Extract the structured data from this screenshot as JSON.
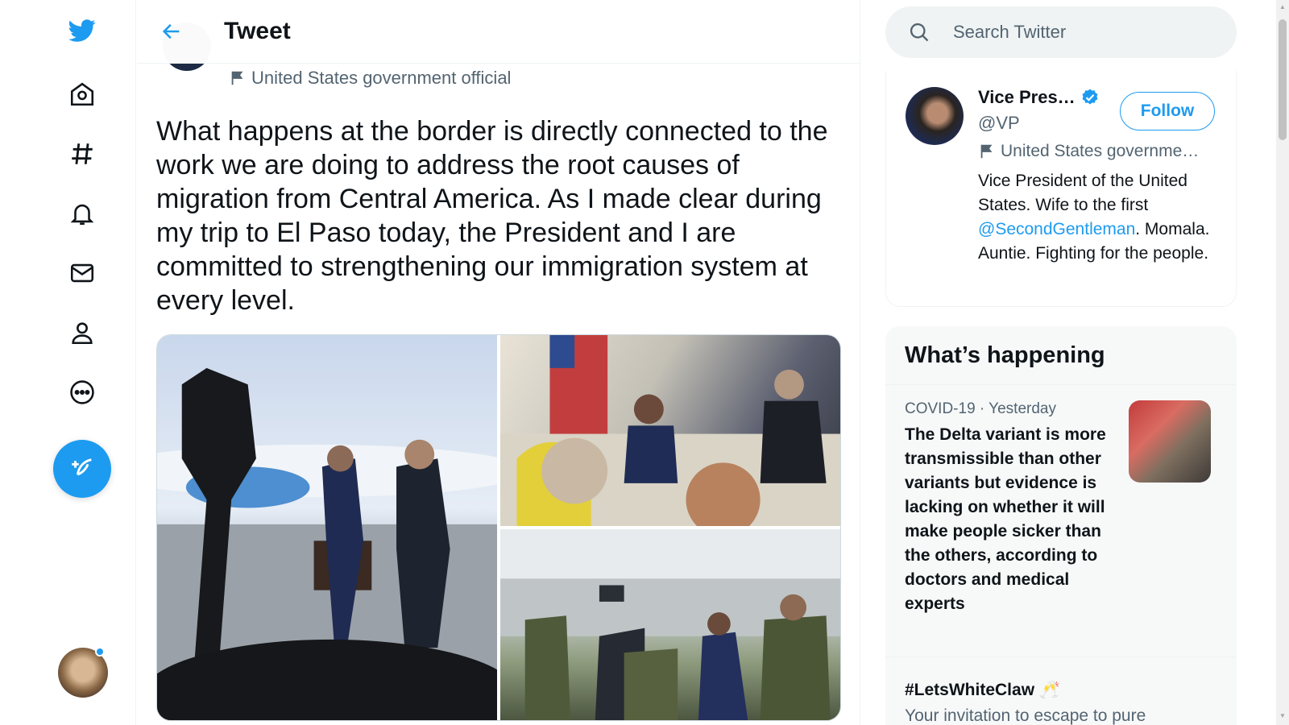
{
  "header": {
    "title": "Tweet"
  },
  "tweet": {
    "author_label": "United States government official",
    "text": "What happens at the border is directly connected to the work we are doing to address the root causes of migration from Central America. As I made clear during my trip to El Paso today, the President and I are committed to strengthening our immigration system at every level."
  },
  "nav": {
    "items": [
      "twitter-logo",
      "home",
      "explore",
      "notifications",
      "messages",
      "profile",
      "more"
    ]
  },
  "search": {
    "placeholder": "Search Twitter"
  },
  "profile_card": {
    "name": "Vice Pres…",
    "handle": "@VP",
    "follow_label": "Follow",
    "label": "United States governme…",
    "bio_before": "Vice President of the United States. Wife to the first ",
    "bio_mention": "@SecondGentleman",
    "bio_after": ". Momala. Auntie. Fighting for the people."
  },
  "trends": {
    "title": "What’s happening",
    "items": [
      {
        "meta": "COVID-19 · Yesterday",
        "headline": "The Delta variant is more transmissible than other variants but evidence is lacking on whether it will make people sicker than the others, according to doctors and medical experts"
      },
      {
        "tag": "#LetsWhiteClaw 🥂",
        "subtitle": "Your invitation to escape to pure"
      }
    ]
  },
  "colors": {
    "accent": "#1d9bf0",
    "text": "#0f1419",
    "muted": "#536471"
  }
}
